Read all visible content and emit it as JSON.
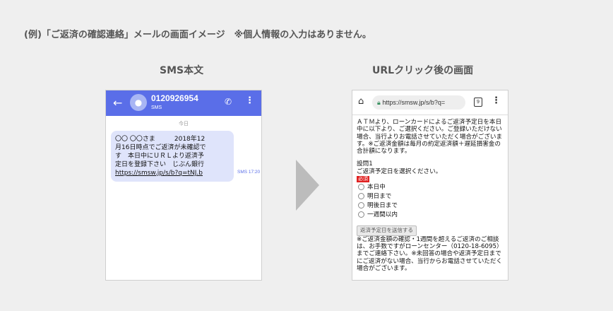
{
  "caption": "(例)「ご返済の確認連絡」メールの画面イメージ　※個人情報の入力はありません。",
  "left_heading": "SMS本文",
  "right_heading": "URLクリック後の画面",
  "sms": {
    "phone_number": "0120926954",
    "tag": "SMS",
    "day_label": "今日",
    "message_line1": "〇〇 〇〇さま　　　2018年12",
    "message_line2": "月16日時点でご返済が未確認で",
    "message_line3": "す　本日中にＵＲＬより返済予",
    "message_line4": "定日を登録下さい　じぶん銀行",
    "message_link": "https://smsw.jp/s/b?q=tNJ.b",
    "timestamp": "SMS 17:20",
    "icons": {
      "back": "back-arrow-icon",
      "avatar": "person-icon",
      "call": "phone-call-icon",
      "menu": "more-vert-icon"
    }
  },
  "browser": {
    "url": "https://smsw.jp/s/b?q=",
    "tab_count": "9",
    "intro": "ＡＴＭより、ローンカードによるご返済予定日を本日中に以下より、ご選択ください。ご登録いただけない場合、当行よりお電話させていただく場合がございます。※ご返済金額は毎月の約定返済額＋遅延損害金の合計額になります。",
    "question_label": "設問1",
    "question_text": "ご返済予定日を選択ください。",
    "required_badge": "必須",
    "options": [
      "本日中",
      "明日まで",
      "明後日まで",
      "一週間以内"
    ],
    "submit_label": "返済予定日を送信する",
    "note": "※ご返済金額の確認・1週間を超えるご返済のご相談は、お手数ですがローンセンター（0120-18-6095）までご連絡下さい。※未回答の場合や返済予定日までにご返済がない場合、当行からお電話させていただく場合がございます。",
    "icons": {
      "home": "home-icon",
      "lock": "lock-icon",
      "tabs": "tabs-icon",
      "menu": "more-vert-icon"
    }
  }
}
